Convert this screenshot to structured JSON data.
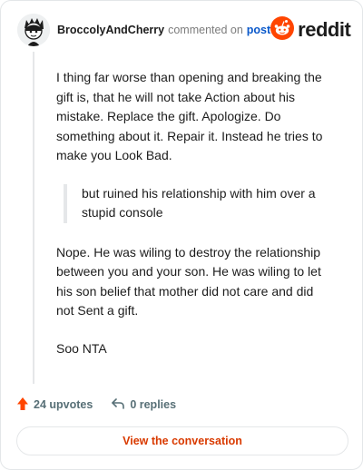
{
  "comment": {
    "username": "BroccolyAndCherry",
    "action_text": "commented on",
    "target_link": "post",
    "paragraphs": [
      "I thing far worse than opening and breaking the gift is, that he will not take Action about his mistake. Replace the gift. Apologize. Do something about it. Repair it. Instead he tries to make you Look Bad."
    ],
    "quote": "but ruined his relationship with him over a stupid console",
    "paragraphs_after": [
      "Nope. He was wiling to destroy the relationship between you and your son. He was wiling to let his son belief that mother did not care and did not Sent a gift.",
      "Soo NTA"
    ]
  },
  "brand": {
    "name": "reddit",
    "color": "#ff4500"
  },
  "actions": {
    "upvotes": "24 upvotes",
    "replies": "0 replies",
    "upvote_color": "#ff4500"
  },
  "cta": {
    "label": "View the conversation"
  },
  "icons": [
    "avatar",
    "reddit-logo-icon",
    "upvote-arrow-icon",
    "reply-arrow-icon"
  ]
}
